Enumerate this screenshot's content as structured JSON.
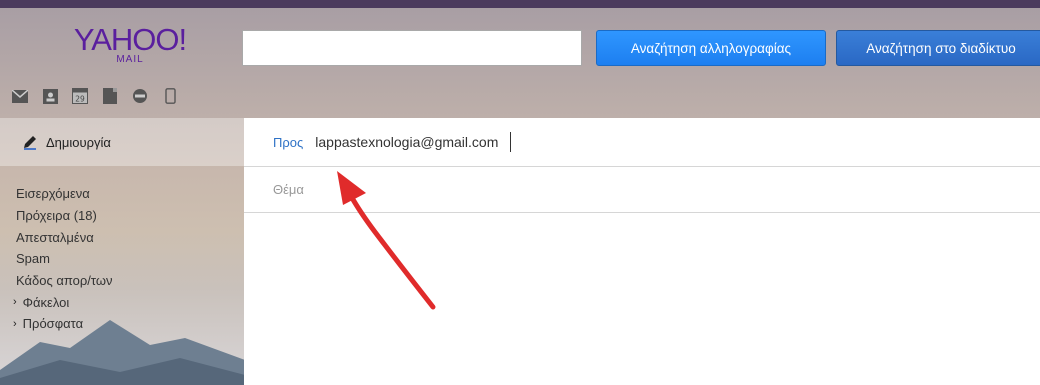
{
  "header": {
    "logo_brand": "YAHOO!",
    "logo_sub": "MAIL",
    "search": {
      "value": "",
      "placeholder": ""
    },
    "search_mail_button": "Αναζήτηση αλληλογραφίας",
    "search_web_button": "Αναζήτηση στο διαδίκτυο"
  },
  "apps": [
    {
      "icon": "mail-icon"
    },
    {
      "icon": "contacts-icon"
    },
    {
      "icon": "calendar-icon",
      "label": "29"
    },
    {
      "icon": "notepad-icon"
    },
    {
      "icon": "messenger-icon"
    },
    {
      "icon": "mobile-icon"
    }
  ],
  "sidebar": {
    "compose_label": "Δημιουργία",
    "folders": [
      {
        "label": "Εισερχόμενα"
      },
      {
        "label": "Πρόχειρα (18)"
      },
      {
        "label": "Απεσταλμένα"
      },
      {
        "label": "Spam"
      },
      {
        "label": "Κάδος απορ/των"
      },
      {
        "label": "Φάκελοι",
        "expandable": true
      },
      {
        "label": "Πρόσφατα",
        "expandable": true
      }
    ]
  },
  "compose": {
    "to_label": "Προς",
    "to_value": "lappastexnologia@gmail.com",
    "subject_label": "Θέμα",
    "subject_value": ""
  },
  "colors": {
    "brand": "#5a1f9e",
    "primary_button": "#1d7ff0",
    "link": "#2f72c6",
    "annotation_arrow": "#e02b2b"
  }
}
